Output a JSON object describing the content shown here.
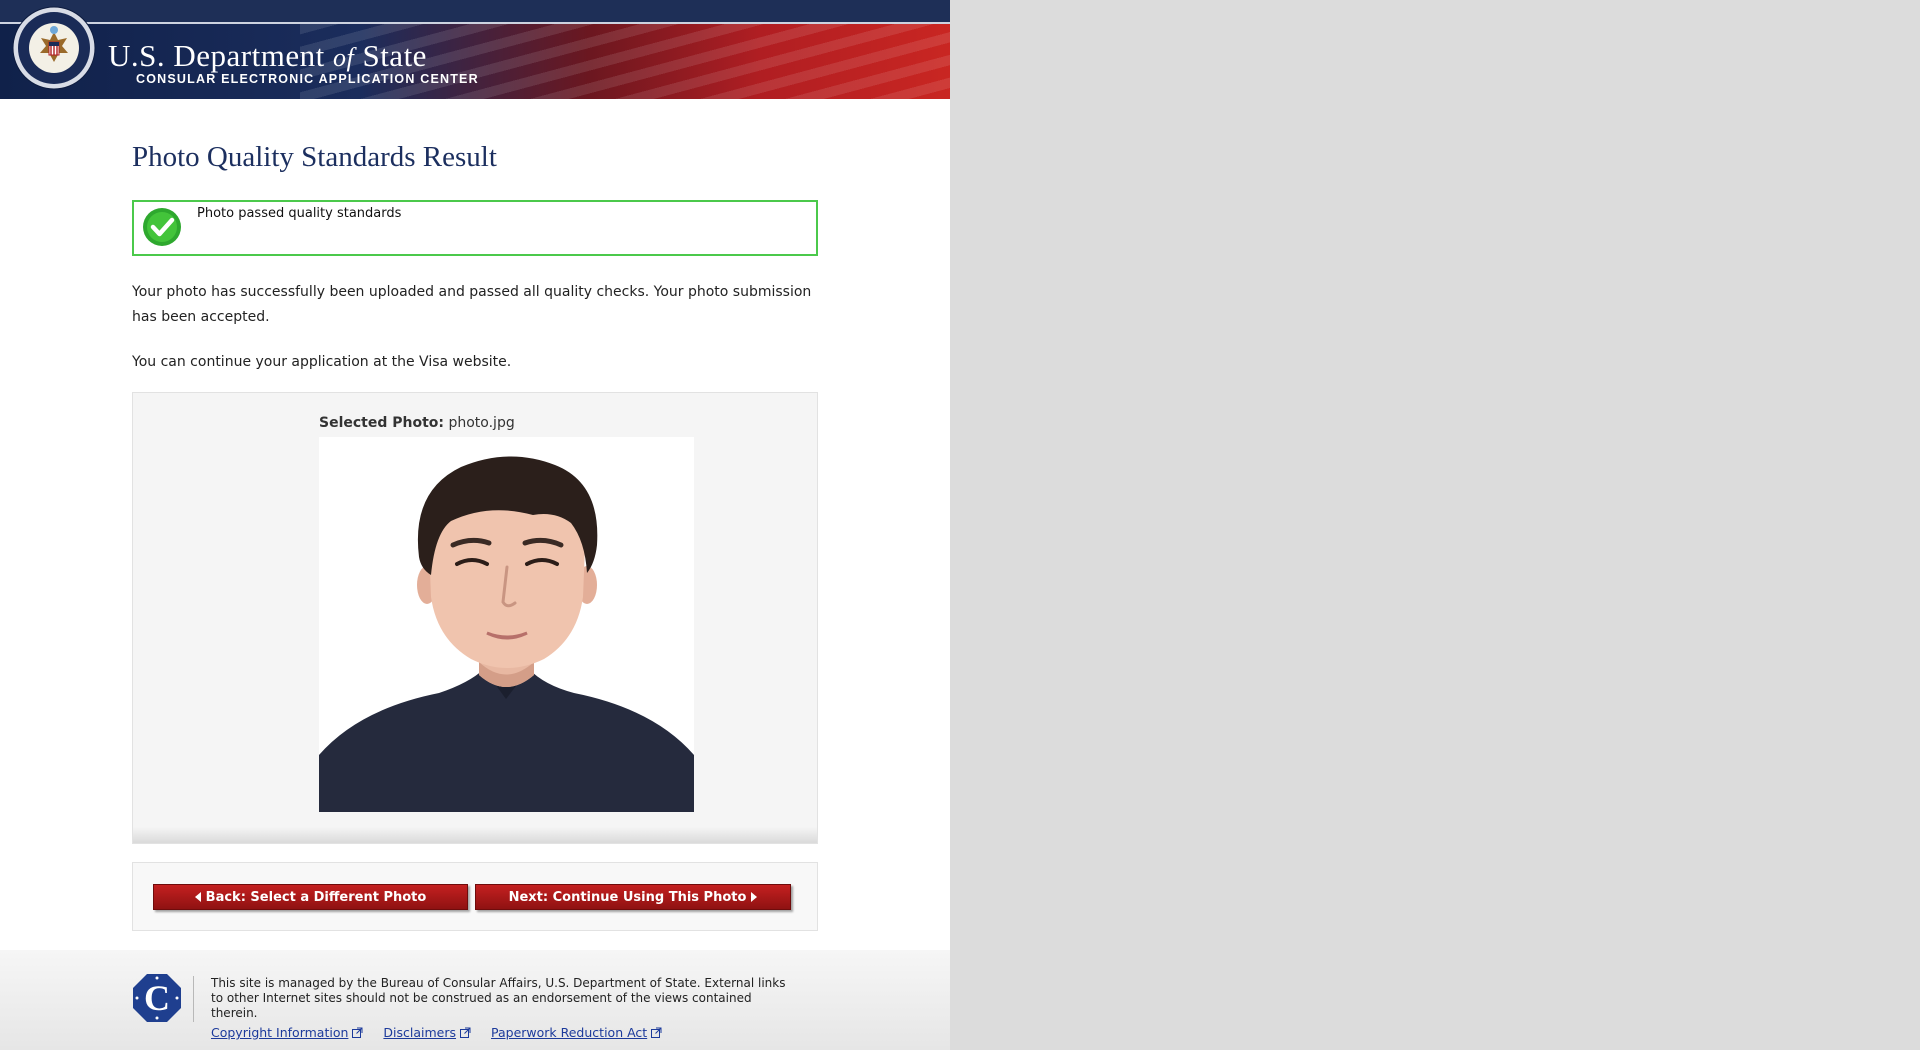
{
  "header": {
    "title_main": "U.S. Department",
    "title_of": "of",
    "title_state": "State",
    "subtitle": "CONSULAR ELECTRONIC APPLICATION CENTER",
    "seal_icon": "department-of-state-seal",
    "seal_text": "DEPARTMENT OF STATE · UNITED STATES OF AMERICA"
  },
  "main": {
    "page_title": "Photo Quality Standards Result",
    "status": {
      "icon": "green-check-icon",
      "text": "Photo passed quality standards"
    },
    "paragraph1": "Your photo has successfully been uploaded and passed all quality checks. Your photo submission has been accepted.",
    "paragraph2": "You can continue your application at the Visa website.",
    "selected_photo": {
      "label": "Selected Photo:",
      "filename": "photo.jpg"
    },
    "buttons": {
      "back": "Back: Select a Different Photo",
      "next": "Next: Continue Using This Photo"
    }
  },
  "footer": {
    "logo_icon": "consular-affairs-c-logo",
    "text": "This site is managed by the Bureau of Consular Affairs, U.S. Department of State. External links to other Internet sites should not be construed as an endorsement of the views contained therein.",
    "links": [
      "Copyright Information",
      "Disclaimers",
      "Paperwork Reduction Act"
    ]
  },
  "colors": {
    "title_navy": "#1c2f5f",
    "success_green": "#4bc94b",
    "button_red": "#b01e22",
    "link_blue": "#1c3a9b",
    "background_gray": "#dcdcdc"
  }
}
